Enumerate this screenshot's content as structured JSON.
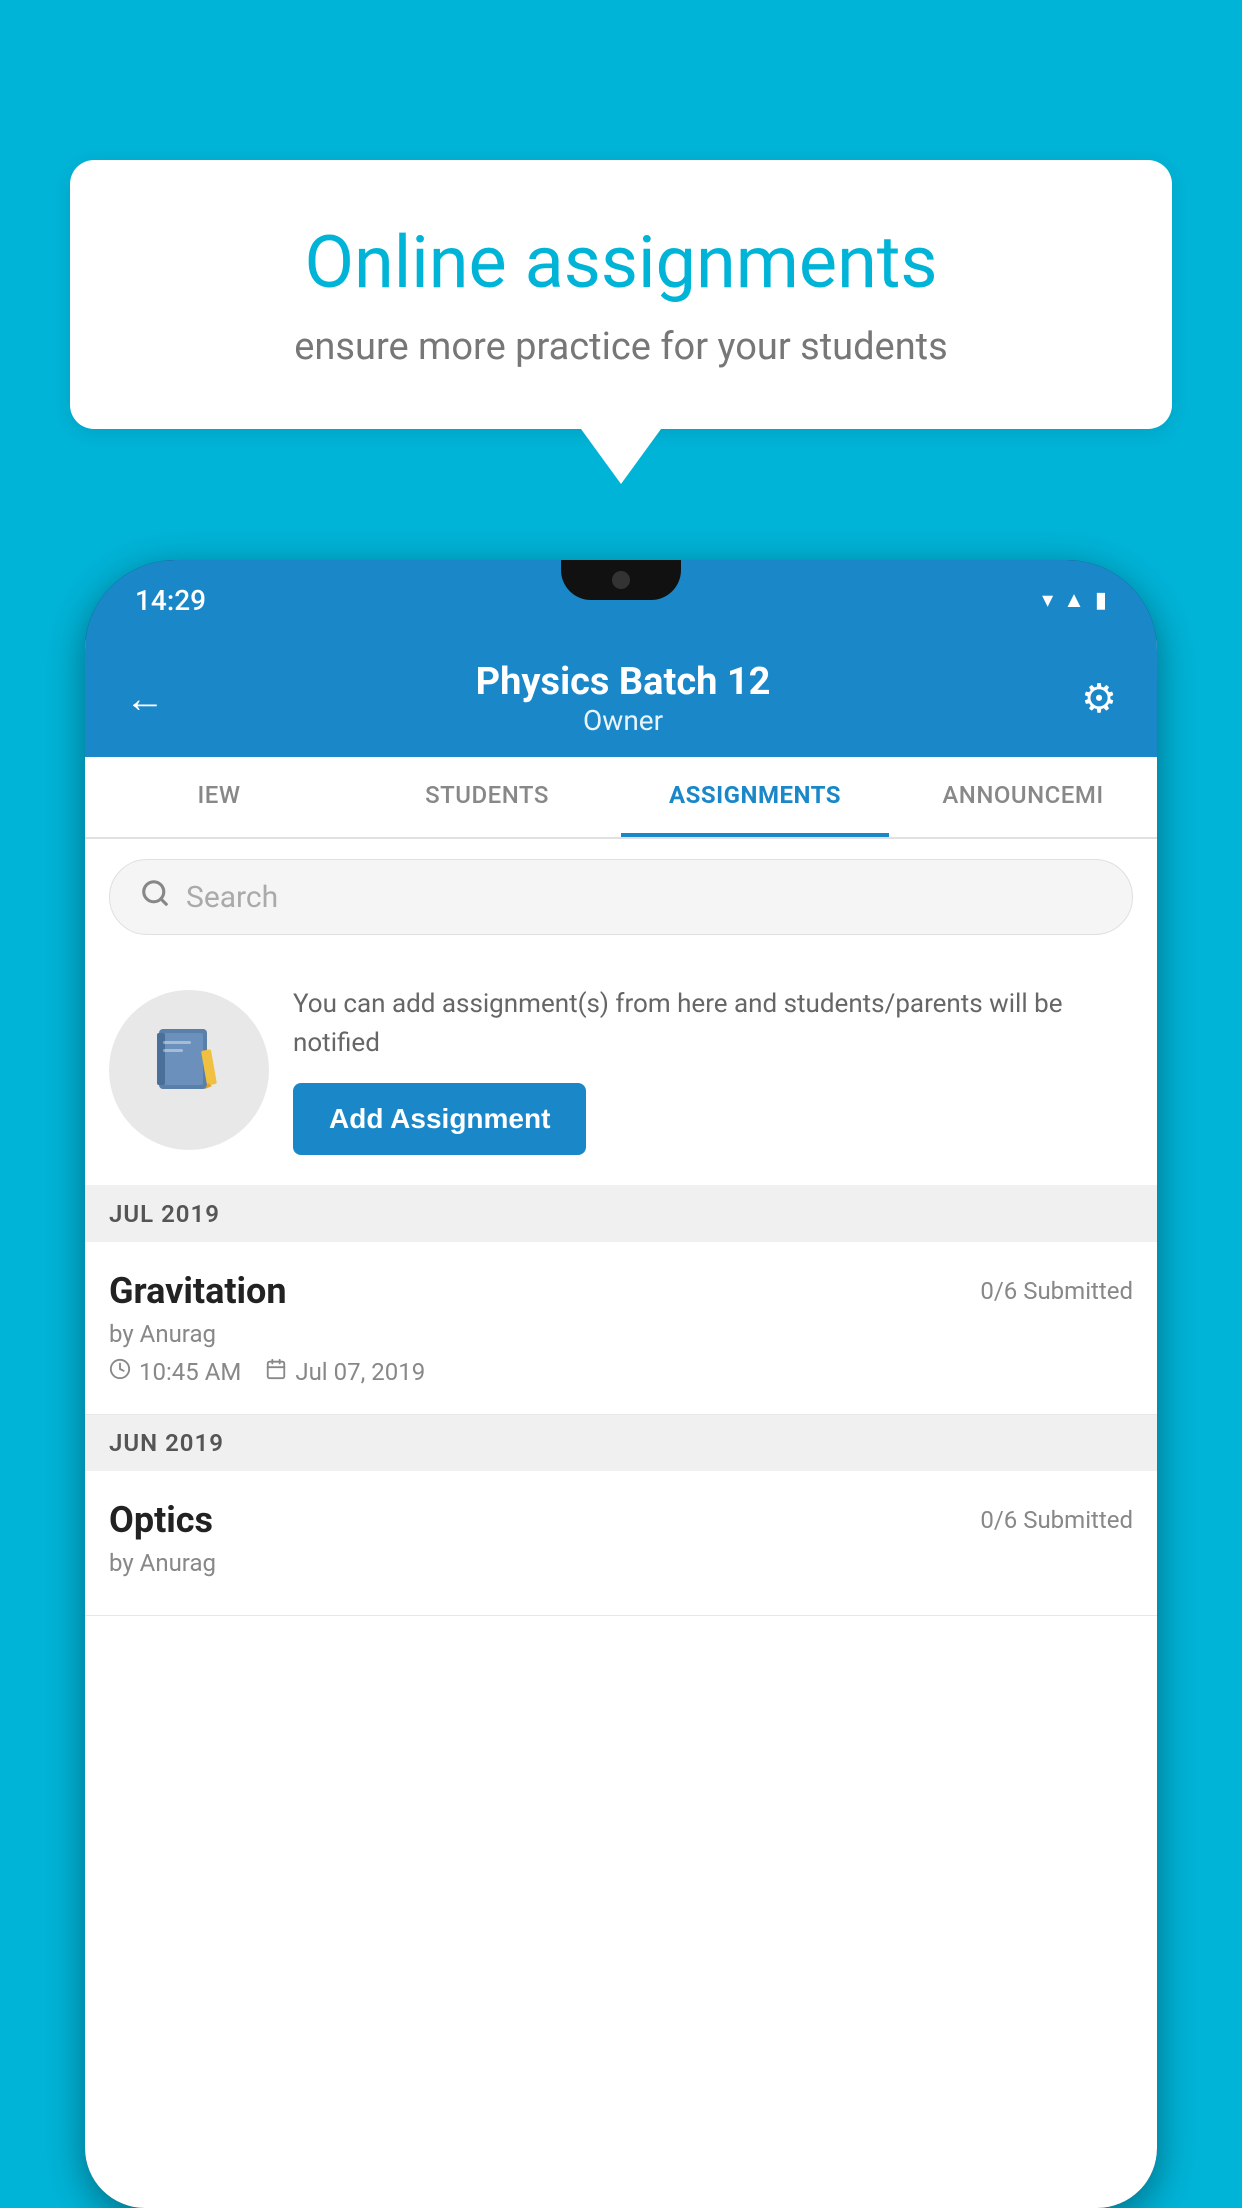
{
  "background_color": "#00B4D8",
  "speech_bubble": {
    "title": "Online assignments",
    "subtitle": "ensure more practice for your students"
  },
  "phone": {
    "status_bar": {
      "time": "14:29",
      "icons": [
        "wifi",
        "signal",
        "battery"
      ]
    },
    "header": {
      "title": "Physics Batch 12",
      "subtitle": "Owner",
      "back_label": "←",
      "settings_label": "⚙"
    },
    "tabs": [
      {
        "label": "IEW",
        "active": false
      },
      {
        "label": "STUDENTS",
        "active": false
      },
      {
        "label": "ASSIGNMENTS",
        "active": true
      },
      {
        "label": "ANNOUNCEMENTS",
        "active": false
      }
    ],
    "search": {
      "placeholder": "Search"
    },
    "promo": {
      "description": "You can add assignment(s) from here and students/parents will be notified",
      "button_label": "Add Assignment"
    },
    "sections": [
      {
        "label": "JUL 2019",
        "assignments": [
          {
            "name": "Gravitation",
            "submitted": "0/6 Submitted",
            "author": "by Anurag",
            "time": "10:45 AM",
            "date": "Jul 07, 2019"
          }
        ]
      },
      {
        "label": "JUN 2019",
        "assignments": [
          {
            "name": "Optics",
            "submitted": "0/6 Submitted",
            "author": "by Anurag",
            "time": "",
            "date": ""
          }
        ]
      }
    ]
  }
}
